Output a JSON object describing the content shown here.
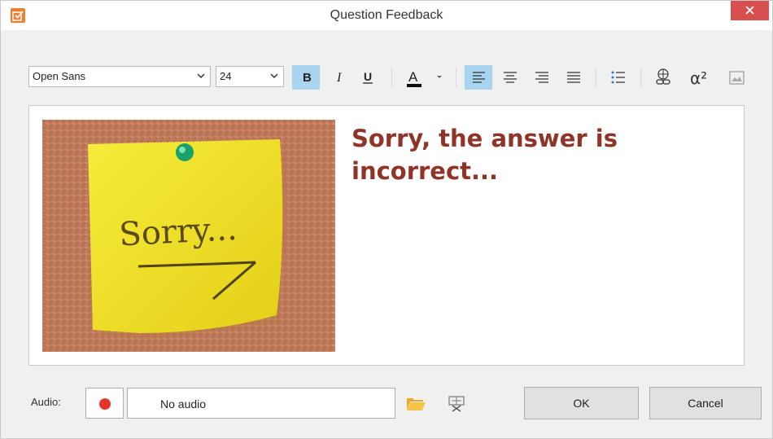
{
  "window": {
    "title": "Question Feedback",
    "app_icon": "edit-checkbox-icon",
    "close_icon": "close-icon"
  },
  "toolbar": {
    "font_family": "Open Sans",
    "font_size": "24",
    "buttons": [
      {
        "name": "bold",
        "label": "B",
        "active": true
      },
      {
        "name": "italic",
        "label": "I",
        "active": false
      },
      {
        "name": "underline",
        "label": "U",
        "active": false
      },
      {
        "name": "font-color",
        "label": "A",
        "active": false
      },
      {
        "name": "align-left",
        "active": true
      },
      {
        "name": "align-center",
        "active": false
      },
      {
        "name": "align-right",
        "active": false
      },
      {
        "name": "align-justify",
        "active": false
      },
      {
        "name": "bullet-list",
        "active": false
      },
      {
        "name": "hyperlink",
        "active": false
      },
      {
        "name": "equation",
        "label": "α²",
        "active": false
      },
      {
        "name": "insert-image",
        "active": false
      }
    ]
  },
  "editor": {
    "note_text": "Sorry...",
    "feedback_text": "Sorry, the answer is incorrect...",
    "feedback_color": "#8f3427"
  },
  "footer": {
    "audio_label": "Audio:",
    "audio_value": "No audio",
    "ok_label": "OK",
    "cancel_label": "Cancel"
  },
  "colors": {
    "accent": "#a9d4f0",
    "close": "#d94f4f",
    "record": "#e5352b",
    "app_icon": "#f07e2a"
  }
}
